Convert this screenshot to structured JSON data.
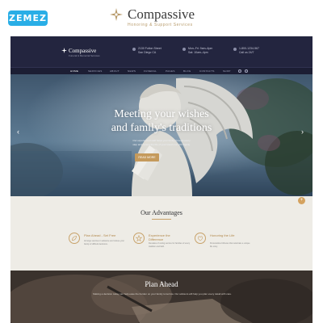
{
  "topbar": {
    "vendor_logo": "ZEMEZ",
    "brand_title": "Compassive",
    "brand_subtitle": "Honoring & Support Services"
  },
  "site_header": {
    "logo": "Compassive",
    "logo_subtitle": "Funeral & Memorial Services",
    "info": [
      {
        "icon": "location-pin-icon",
        "lines": [
          "2130 Fulton Street",
          "San Diego CA"
        ]
      },
      {
        "icon": "clock-icon",
        "lines": [
          "Mon–Fri: 9am–6pm",
          "Sat: 10am–4pm"
        ]
      },
      {
        "icon": "phone-icon",
        "lines": [
          "1-800-1234-567",
          "Call us 24/7"
        ]
      }
    ]
  },
  "nav": {
    "items": [
      "HOME",
      "SERVICES",
      "ABOUT",
      "NEWS",
      "FUNERAL",
      "PAGES",
      "BLOG",
      "CONTACTS",
      "SHOP"
    ],
    "active_index": 0
  },
  "hero": {
    "title_line1": "Meeting your wishes",
    "title_line2": "and family's traditions",
    "text": "Our experienced staff helps your family through every step and honors the life of your loved one with dignity.",
    "button": "READ MORE",
    "prev_icon": "chevron-left-icon",
    "next_icon": "chevron-right-icon",
    "fab": "+"
  },
  "advantages": {
    "title": "Our Advantages",
    "items": [
      {
        "icon": "leaf-icon",
        "heading": "Plan Ahead - Set Free",
        "text": "Arrange services in advance and relieve your family of difficult decisions."
      },
      {
        "icon": "star-icon",
        "heading": "Experience the Difference",
        "text": "Decades of caring service for families of every tradition and faith."
      },
      {
        "icon": "heart-icon",
        "heading": "Honoring the Life",
        "text": "Personalized tributes that celebrate a unique life story."
      }
    ]
  },
  "plan": {
    "title": "Plan Ahead",
    "text": "Making a decision today can help ease the burden on your family tomorrow. Our advisors will help you plan every detail with care."
  },
  "colors": {
    "header_bg": "#23253f",
    "accent_gold": "#c59a5c",
    "vendor_blue": "#29aee6",
    "advantages_bg": "#eeece6"
  }
}
